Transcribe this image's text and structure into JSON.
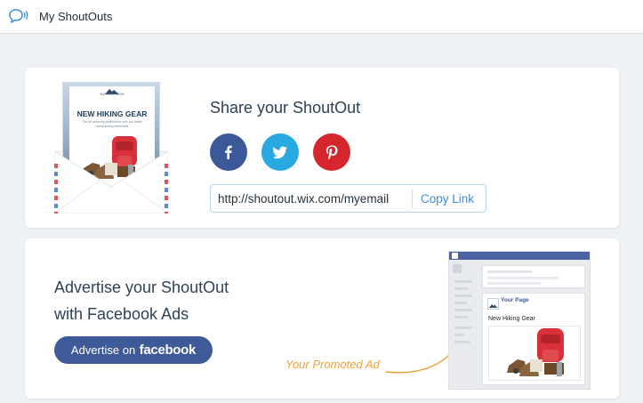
{
  "header": {
    "title": "My ShoutOuts",
    "logo_icon": "speech-bubble-icon"
  },
  "share_card": {
    "preview": {
      "brand": "NATURE NOW",
      "headline": "NEW HIKING GEAR",
      "subtext": "Get all amazing adventures with our latest backpacking essentials"
    },
    "title": "Share your ShoutOut",
    "social": [
      {
        "name": "facebook",
        "icon": "facebook-icon",
        "color": "#3b5998"
      },
      {
        "name": "twitter",
        "icon": "twitter-icon",
        "color": "#29a9e1"
      },
      {
        "name": "pinterest",
        "icon": "pinterest-icon",
        "color": "#d4262c"
      }
    ],
    "link": {
      "url": "http://shoutout.wix.com/myemail",
      "copy_label": "Copy Link"
    }
  },
  "ad_card": {
    "title_line1": "Advertise your ShoutOut",
    "title_line2": "with Facebook Ads",
    "button_prefix": "Advertise on",
    "button_brand": "facebook",
    "promo_label": "Your Promoted Ad",
    "mock": {
      "page_name": "Your Page",
      "post_text": "New Hiking Gear"
    }
  },
  "colors": {
    "accent": "#3d8ed8",
    "promo": "#f0a033",
    "facebook_button": "#3e5a98"
  }
}
